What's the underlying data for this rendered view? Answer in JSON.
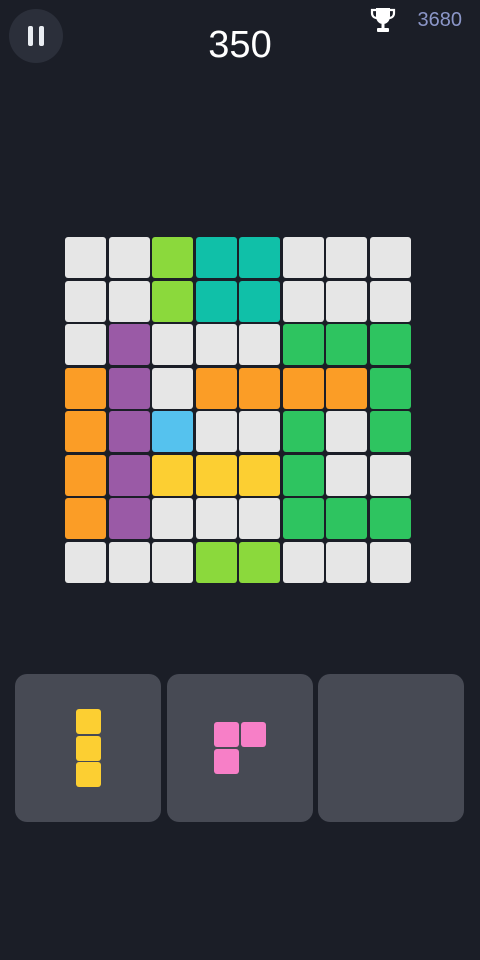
{
  "header": {
    "score": "350",
    "best_score": "3680",
    "pause_icon": "pause-icon",
    "trophy_icon": "trophy-icon"
  },
  "colors": {
    "W": "#e6e6e6",
    "L": "#8bd93c",
    "T": "#10c0a8",
    "G": "#2ec460",
    "P": "#9a5aa6",
    "O": "#fb9d26",
    "B": "#55c2ee",
    "Y": "#fccf32",
    "K": "#f77fc7"
  },
  "board": {
    "rows": [
      [
        "W",
        "W",
        "L",
        "T",
        "T",
        "W",
        "W",
        "W"
      ],
      [
        "W",
        "W",
        "L",
        "T",
        "T",
        "W",
        "W",
        "W"
      ],
      [
        "W",
        "P",
        "W",
        "W",
        "W",
        "G",
        "G",
        "G"
      ],
      [
        "O",
        "P",
        "W",
        "O",
        "O",
        "O",
        "O",
        "G"
      ],
      [
        "O",
        "P",
        "B",
        "W",
        "W",
        "G",
        "W",
        "G"
      ],
      [
        "O",
        "P",
        "Y",
        "Y",
        "Y",
        "G",
        "W",
        "W"
      ],
      [
        "O",
        "P",
        "W",
        "W",
        "W",
        "G",
        "G",
        "G"
      ],
      [
        "W",
        "W",
        "W",
        "L",
        "L",
        "W",
        "W",
        "W"
      ]
    ]
  },
  "tray": [
    {
      "name": "vertical-three",
      "color": "Y",
      "cells": [
        [
          0,
          0
        ],
        [
          1,
          0
        ],
        [
          2,
          0
        ]
      ]
    },
    {
      "name": "corner-three",
      "color": "K",
      "cells": [
        [
          0,
          0
        ],
        [
          0,
          1
        ],
        [
          1,
          0
        ]
      ]
    },
    {
      "name": "empty",
      "color": null,
      "cells": []
    }
  ]
}
